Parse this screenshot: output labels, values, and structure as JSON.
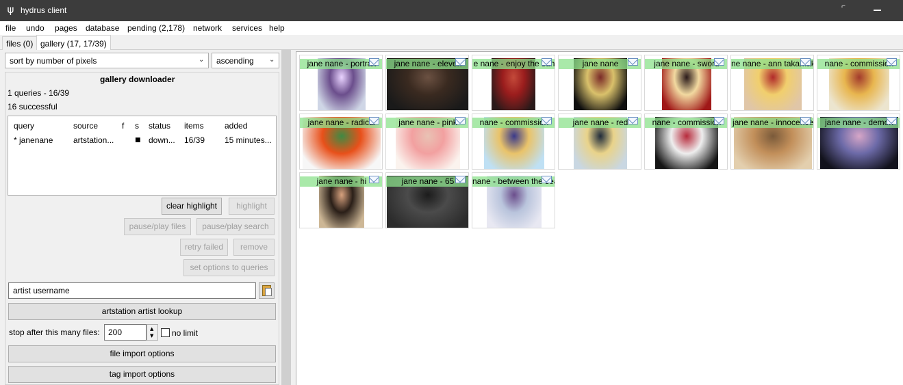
{
  "window": {
    "title": "hydrus client",
    "icon": "psi-logo-icon"
  },
  "menu": [
    "file",
    "undo",
    "pages",
    "database",
    "pending (2,178)",
    "network",
    "services",
    "help"
  ],
  "tabs": [
    {
      "label": "files (0)",
      "active": false
    },
    {
      "label": "gallery (17, 17/39)",
      "active": true
    }
  ],
  "sort": {
    "value": "sort by number of pixels",
    "order": "ascending"
  },
  "downloader": {
    "title": "gallery downloader",
    "queries_status": "1 queries - 16/39",
    "success_status": "16 successful",
    "columns": [
      "query",
      "source",
      "f",
      "s",
      "status",
      "items",
      "added"
    ],
    "rows": [
      {
        "query": "* janenane",
        "source": "artstation...",
        "f": "",
        "s": "■",
        "status": "down...",
        "items": "16/39",
        "added": "15 minutes..."
      }
    ]
  },
  "buttons": {
    "clear_highlight": "clear highlight",
    "highlight": "highlight",
    "pause_files": "pause/play files",
    "pause_search": "pause/play search",
    "retry_failed": "retry failed",
    "remove": "remove",
    "set_options": "set options to queries",
    "lookup": "artstation artist lookup",
    "file_import": "file import options",
    "tag_import": "tag import options"
  },
  "input": {
    "placeholder": "artist username"
  },
  "limit": {
    "label": "stop after this many files:",
    "value": "200",
    "no_limit": "no limit"
  },
  "thumbnails": [
    {
      "caption": "jane nane - portrait",
      "colors": [
        "#cfd6e6",
        "#6b4e8c",
        "#e9d3ff"
      ]
    },
    {
      "caption": "jane nane - eleven",
      "colors": [
        "#1a1a1a",
        "#3a2a20",
        "#6b5142"
      ]
    },
    {
      "caption": "e nane - enjoy the sun",
      "colors": [
        "#2a1a1a",
        "#9b1d1d",
        "#c44a3a"
      ]
    },
    {
      "caption": "jane nane",
      "colors": [
        "#0f0f0f",
        "#d9c16b",
        "#7b2b28"
      ]
    },
    {
      "caption": "jane nane - sword",
      "colors": [
        "#a01818",
        "#f2d9a0",
        "#2a1a1a"
      ]
    },
    {
      "caption": "ne nane - ann takamaki",
      "colors": [
        "#e0c6a8",
        "#f1cf6d",
        "#b12a2a"
      ]
    },
    {
      "caption": "nane - commission",
      "colors": [
        "#ece5cf",
        "#e8b64f",
        "#a33b2c"
      ]
    },
    {
      "caption": "jane nane - radical",
      "colors": [
        "#f7f7f7",
        "#e8501a",
        "#3f8a43"
      ]
    },
    {
      "caption": "jane nane - pink",
      "colors": [
        "#fbf3ee",
        "#f2a0a0",
        "#e9c2b4"
      ]
    },
    {
      "caption": "nane - commission",
      "colors": [
        "#bfe0f4",
        "#e9c36a",
        "#3b3a8a"
      ]
    },
    {
      "caption": "jane nane - red",
      "colors": [
        "#c9d7e2",
        "#e9d38a",
        "#1f2b3a"
      ]
    },
    {
      "caption": "nane - commission",
      "colors": [
        "#151515",
        "#eeeeee",
        "#b72b3c"
      ]
    },
    {
      "caption": "jane nane - innocence",
      "colors": [
        "#e3cfae",
        "#c28f5a",
        "#7a5a3a"
      ]
    },
    {
      "caption": "jane nane - demon",
      "colors": [
        "#12121c",
        "#6c6aa8",
        "#d6a6c7"
      ]
    },
    {
      "caption": "jane nane - hi",
      "colors": [
        "#cdb796",
        "#2a1f18",
        "#d7a17e"
      ]
    },
    {
      "caption": "jane nane - 65",
      "colors": [
        "#2c2c2c",
        "#4b4b4b",
        "#1c1c1c"
      ]
    },
    {
      "caption": "nane - between the seas",
      "colors": [
        "#e8e8f2",
        "#b9c4dc",
        "#6b4e8c"
      ]
    }
  ]
}
